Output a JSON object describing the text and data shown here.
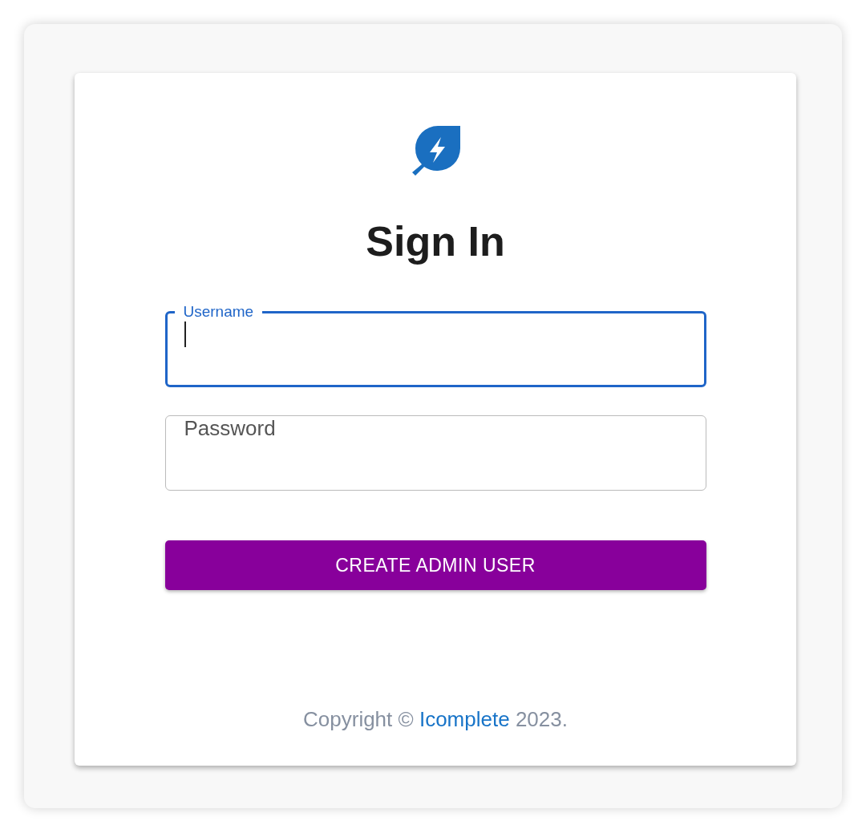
{
  "title": "Sign In",
  "fields": [
    {
      "label": "Username",
      "focused": true
    },
    {
      "label": "Password",
      "focused": false
    }
  ],
  "button": "CREATE ADMIN USER",
  "footer": {
    "before": "Copyright © ",
    "link": "Icomplete",
    "after": " 2023."
  }
}
